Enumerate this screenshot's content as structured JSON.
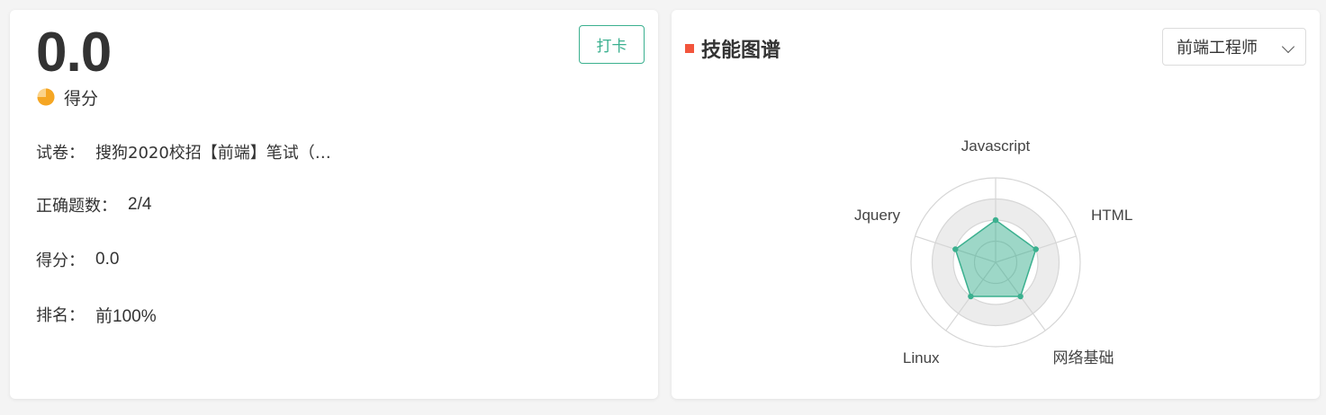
{
  "result": {
    "score_value": "0.0",
    "score_label": "得分",
    "checkin_label": "打卡",
    "rows": [
      {
        "key": "试卷：",
        "value": "搜狗2020校招【前端】笔试（…"
      },
      {
        "key": "正确题数：",
        "value": "2/4"
      },
      {
        "key": "得分：",
        "value": "0.0"
      },
      {
        "key": "排名：",
        "value": "前100%"
      }
    ]
  },
  "skills": {
    "title": "技能图谱",
    "role_select": {
      "value": "前端工程师"
    },
    "colors": {
      "marker": "#f2553c",
      "accent": "#3bb08f",
      "pie": "#f5a623"
    },
    "chart_data": {
      "type": "radar",
      "axes": [
        "Javascript",
        "HTML",
        "网络基础",
        "Linux",
        "Jquery"
      ],
      "values": [
        0.5,
        0.5,
        0.5,
        0.5,
        0.5
      ],
      "range": [
        0,
        1
      ],
      "rings": 4
    }
  }
}
